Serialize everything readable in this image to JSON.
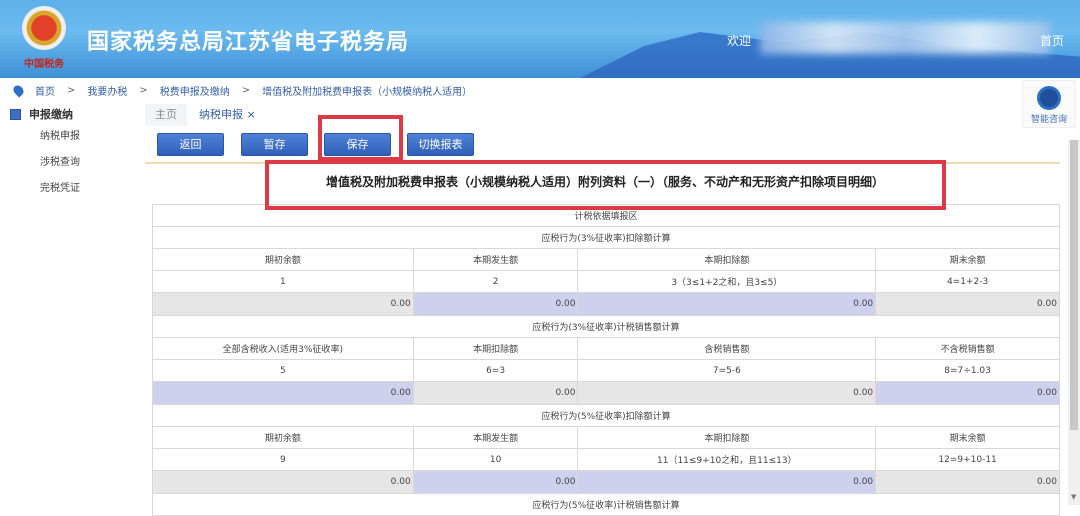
{
  "header": {
    "title": "国家税务总局江苏省电子税务局",
    "logo_sub": "中国税务",
    "welcome": "欢迎",
    "home_link": "首页"
  },
  "breadcrumb": [
    "首页",
    "我要办税",
    "税费申报及缴纳",
    "增值税及附加税费申报表（小规模纳税人适用）"
  ],
  "sidebar": {
    "title": "申报缴纳",
    "items": [
      "纳税申报",
      "涉税查询",
      "完税凭证"
    ]
  },
  "tabs": [
    {
      "label": "主页"
    },
    {
      "label": "纳税申报 ×"
    }
  ],
  "toolbar": {
    "back": "返回",
    "temp_save": "暂存",
    "save": "保存",
    "switch": "切换报表"
  },
  "form_title": "增值税及附加税费申报表（小规模纳税人适用）附列资料（一）（服务、不动产和无形资产扣除项目明细）",
  "help": {
    "label": "智能咨询"
  },
  "table": {
    "area_title": "计税依据填报区",
    "sections": [
      {
        "title": "应税行为(3%征收率)扣除额计算",
        "headers": [
          "期初余额",
          "本期发生额",
          "本期扣除额",
          "期末余额"
        ],
        "nums": [
          "1",
          "2",
          "3（3≤1+2之和，且3≤5）",
          "4=1+2-3"
        ],
        "values": [
          "0.00",
          "0.00",
          "0.00",
          "0.00"
        ]
      },
      {
        "title": "应税行为(3%征收率)计税销售额计算",
        "headers": [
          "全部含税收入(适用3%征收率)",
          "本期扣除额",
          "含税销售额",
          "不含税销售额"
        ],
        "nums": [
          "5",
          "6=3",
          "7=5-6",
          "8=7÷1.03"
        ],
        "values": [
          "0.00",
          "0.00",
          "0.00",
          "0.00"
        ]
      },
      {
        "title": "应税行为(5%征收率)扣除额计算",
        "headers": [
          "期初余额",
          "本期发生额",
          "本期扣除额",
          "期末余额"
        ],
        "nums": [
          "9",
          "10",
          "11（11≤9+10之和，且11≤13）",
          "12=9+10-11"
        ],
        "values": [
          "0.00",
          "0.00",
          "0.00",
          "0.00"
        ]
      }
    ],
    "last_section_title": "应税行为(5%征收率)计税销售额计算"
  }
}
